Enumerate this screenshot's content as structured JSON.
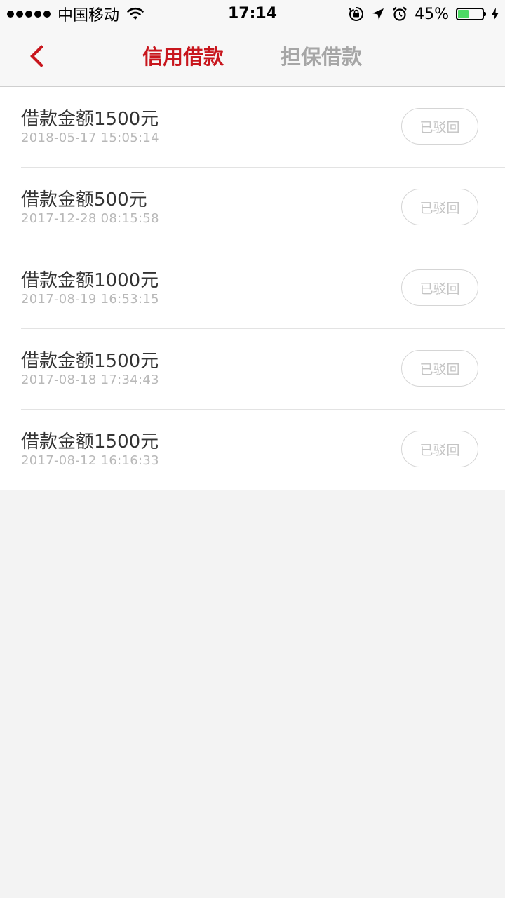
{
  "status_bar": {
    "carrier": "中国移动",
    "time": "17:14",
    "battery_percent": "45%",
    "battery_level": 0.45
  },
  "nav": {
    "tabs": [
      {
        "label": "信用借款",
        "active": true
      },
      {
        "label": "担保借款",
        "active": false
      }
    ]
  },
  "colors": {
    "accent": "#c8161d",
    "inactive_tab": "#a6a6a6",
    "battery_green": "#4cd964"
  },
  "loans": [
    {
      "amount": "借款金额1500元",
      "date": "2018-05-17 15:05:14",
      "status": "已驳回"
    },
    {
      "amount": "借款金额500元",
      "date": "2017-12-28 08:15:58",
      "status": "已驳回"
    },
    {
      "amount": "借款金额1000元",
      "date": "2017-08-19 16:53:15",
      "status": "已驳回"
    },
    {
      "amount": "借款金额1500元",
      "date": "2017-08-18 17:34:43",
      "status": "已驳回"
    },
    {
      "amount": "借款金额1500元",
      "date": "2017-08-12 16:16:33",
      "status": "已驳回"
    }
  ]
}
